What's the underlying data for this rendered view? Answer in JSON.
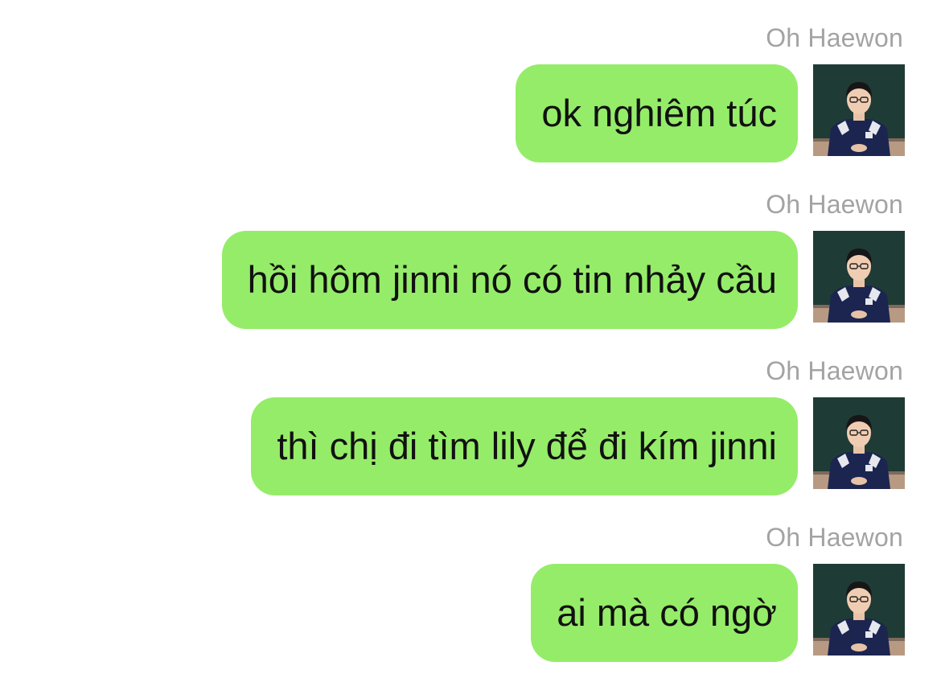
{
  "chat": {
    "accent_bubble_color": "#95ec69",
    "messages": [
      {
        "sender": "Oh Haewon",
        "text": "ok nghiêm túc",
        "avatar": "user-avatar-photo"
      },
      {
        "sender": "Oh Haewon",
        "text": "hồi hôm jinni nó có tin nhảy cầu",
        "avatar": "user-avatar-photo"
      },
      {
        "sender": "Oh Haewon",
        "text": "thì chị đi tìm lily để đi kím jinni",
        "avatar": "user-avatar-photo"
      },
      {
        "sender": "Oh Haewon",
        "text": "ai mà có ngờ",
        "avatar": "user-avatar-photo"
      }
    ]
  }
}
